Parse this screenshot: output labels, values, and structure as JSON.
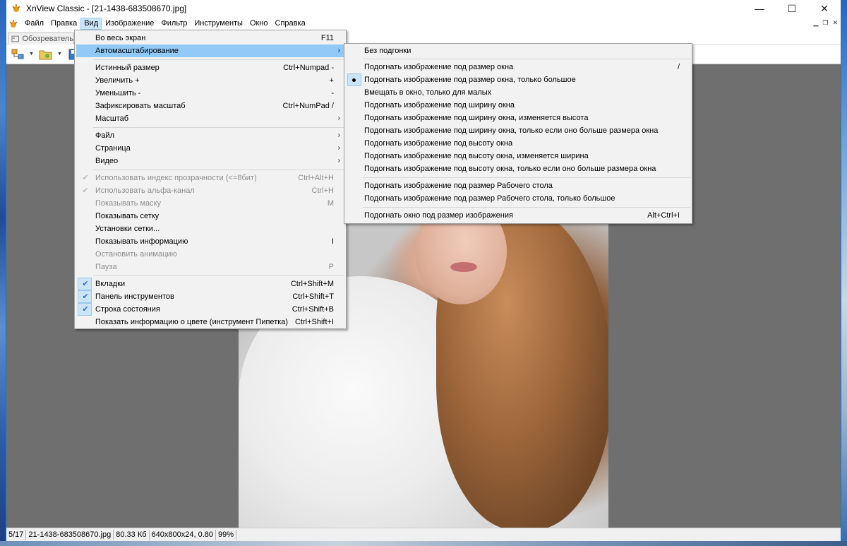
{
  "window": {
    "title": "XnView Classic - [21-1438-683508670.jpg]",
    "minimize": "—",
    "maximize": "☐",
    "close": "✕"
  },
  "menubar": {
    "items": [
      "Файл",
      "Правка",
      "Вид",
      "Изображение",
      "Фильтр",
      "Инструменты",
      "Окно",
      "Справка"
    ],
    "active_index": 2
  },
  "tabs": [
    {
      "label": "Обозреватель"
    }
  ],
  "view_menu": {
    "items": [
      {
        "label": "Во весь экран",
        "shortcut": "F11"
      },
      {
        "label": "Автомасштабирование",
        "submenu": true,
        "highlighted": true
      },
      {
        "separator": true
      },
      {
        "label": "Истинный размер",
        "shortcut": "Ctrl+Numpad -"
      },
      {
        "label": "Увеличить +",
        "shortcut": "+"
      },
      {
        "label": "Уменьшить -",
        "shortcut": "-"
      },
      {
        "label": "Зафиксировать масштаб",
        "shortcut": "Ctrl+NumPad /"
      },
      {
        "label": "Масштаб",
        "submenu": true
      },
      {
        "separator": true
      },
      {
        "label": "Файл",
        "submenu": true
      },
      {
        "label": "Страница",
        "submenu": true
      },
      {
        "label": "Видео",
        "submenu": true
      },
      {
        "separator": true
      },
      {
        "label": "Использовать индекс прозрачности (<=8бит)",
        "shortcut": "Ctrl+Alt+H",
        "disabled": true,
        "checked_dim": true
      },
      {
        "label": "Использовать альфа-канал",
        "shortcut": "Ctrl+H",
        "disabled": true,
        "checked_dim": true
      },
      {
        "label": "Показывать маску",
        "shortcut": "M",
        "disabled": true
      },
      {
        "label": "Показывать сетку"
      },
      {
        "label": "Установки сетки..."
      },
      {
        "label": "Показывать информацию",
        "shortcut": "I"
      },
      {
        "label": "Остановить анимацию",
        "disabled": true
      },
      {
        "label": "Пауза",
        "shortcut": "P",
        "disabled": true
      },
      {
        "separator": true
      },
      {
        "label": "Вкладки",
        "shortcut": "Ctrl+Shift+M",
        "checked": true
      },
      {
        "label": "Панель инструментов",
        "shortcut": "Ctrl+Shift+T",
        "checked": true
      },
      {
        "label": "Строка состояния",
        "shortcut": "Ctrl+Shift+B",
        "checked": true
      },
      {
        "label": "Показать информацию о цвете (инструмент Пипетка)",
        "shortcut": "Ctrl+Shift+I"
      }
    ]
  },
  "autoscale_submenu": {
    "items": [
      {
        "label": "Без подгонки"
      },
      {
        "separator": true
      },
      {
        "label": "Подогнать изображение под размер окна",
        "shortcut": "/"
      },
      {
        "label": "Подогнать изображение под размер окна, только большое",
        "selected": true
      },
      {
        "label": "Вмещать в окно, только для малых"
      },
      {
        "label": "Подогнать изображение под ширину окна"
      },
      {
        "label": "Подогнать изображение под ширину окна, изменяется высота"
      },
      {
        "label": "Подогнать изображение под ширину окна, только если оно больше размера окна"
      },
      {
        "label": "Подогнать изображение под высоту окна"
      },
      {
        "label": "Подогнать изображение под высоту окна, изменяется ширина"
      },
      {
        "label": "Подогнать изображение под высоту окна, только если оно больше размера окна"
      },
      {
        "separator": true
      },
      {
        "label": "Подогнать изображение под размер Рабочего стола"
      },
      {
        "label": "Подогнать изображение под размер Рабочего стола, только большое"
      },
      {
        "separator": true
      },
      {
        "label": "Подогнать окно под размер изображения",
        "shortcut": "Alt+Ctrl+I"
      }
    ]
  },
  "statusbar": {
    "index": "5/17",
    "filename": "21-1438-683508670.jpg",
    "filesize": "80.33 Кб",
    "dimensions": "640x800x24, 0.80",
    "zoom": "99%"
  },
  "icons": {
    "app": "xnview-logo-icon",
    "tab": "browser-tab-icon",
    "toolbar": [
      "browser-icon",
      "open-folder-icon",
      "save-icon"
    ]
  }
}
